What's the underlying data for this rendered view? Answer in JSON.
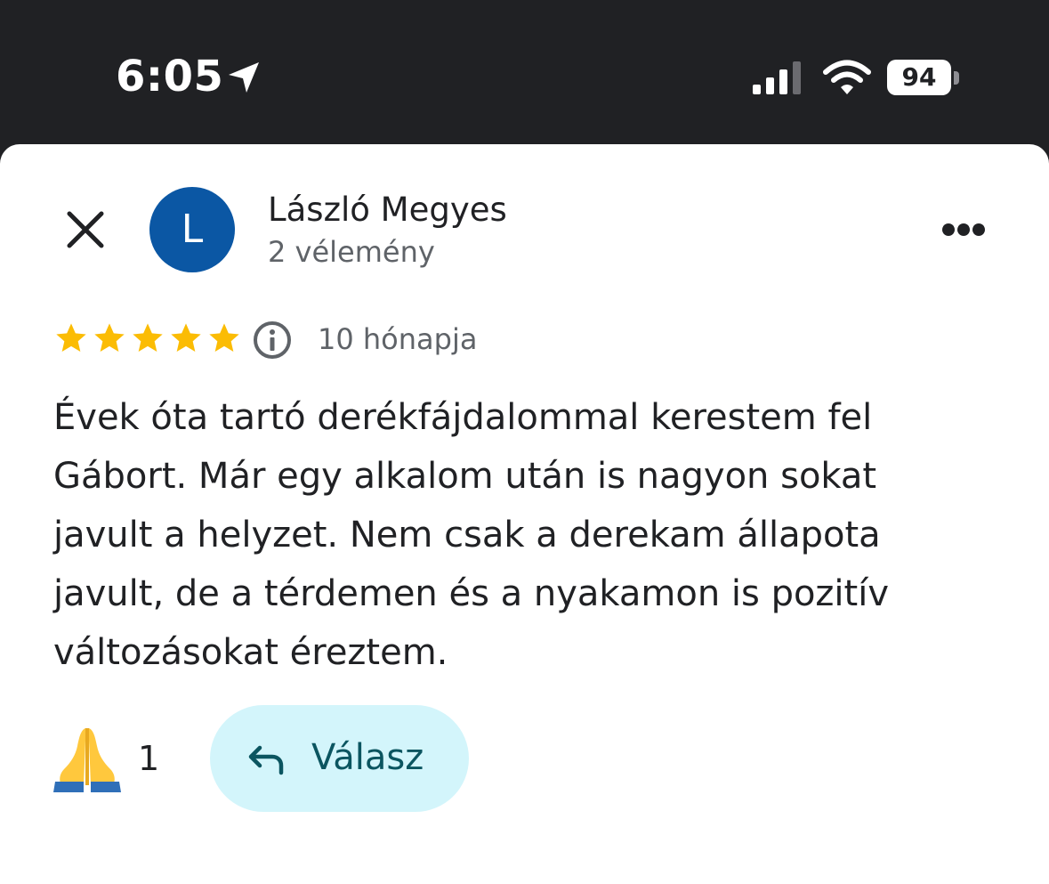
{
  "status_bar": {
    "time": "6:05",
    "battery": "94",
    "icons": [
      "location-arrow-icon",
      "cellular-signal-icon",
      "wifi-icon",
      "battery-icon"
    ]
  },
  "review": {
    "reviewer_initial": "L",
    "reviewer_name": "László Megyes",
    "review_count": "2 vélemény",
    "rating": 5,
    "date": "10 hónapja",
    "text_lines": [
      "Évek óta tartó derékfájdalommal kerestem fel",
      "Gábort. Már egy alkalom után is nagyon sokat",
      "javult a helyzet. Nem csak a derekam állapota",
      "javult, de a térdemen és a nyakamon is pozitív",
      "változásokat éreztem."
    ],
    "reaction_emoji": "🙏",
    "reaction_count": "1",
    "reply_label": "Válasz"
  },
  "colors": {
    "status_bar_bg": "#202124",
    "avatar_bg": "#0b57a4",
    "star": "#fbbc04",
    "reply_bg": "#d3f5fb",
    "reply_text": "#0b5560"
  }
}
